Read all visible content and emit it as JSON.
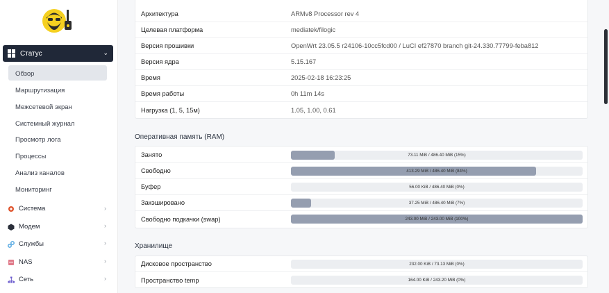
{
  "sidebar": {
    "status_label": "Статус",
    "sub_items": [
      {
        "label": "Обзор"
      },
      {
        "label": "Маршрутизация"
      },
      {
        "label": "Межсетевой экран"
      },
      {
        "label": "Системный журнал"
      },
      {
        "label": "Просмотр лога"
      },
      {
        "label": "Процессы"
      },
      {
        "label": "Анализ каналов"
      },
      {
        "label": "Мониторинг"
      }
    ],
    "groups": [
      {
        "label": "Система",
        "icon": "gear-icon",
        "color": "#e0552e"
      },
      {
        "label": "Модем",
        "icon": "cube-icon",
        "color": "#2a2f3a"
      },
      {
        "label": "Службы",
        "icon": "link-icon",
        "color": "#4aa3e0"
      },
      {
        "label": "NAS",
        "icon": "storage-icon",
        "color": "#e07a8a"
      },
      {
        "label": "Сеть",
        "icon": "network-icon",
        "color": "#6a5acd"
      }
    ]
  },
  "system": {
    "rows": [
      {
        "label": "Архитектура",
        "value": "ARMv8 Processor rev 4"
      },
      {
        "label": "Целевая платформа",
        "value": "mediatek/filogic"
      },
      {
        "label": "Версия прошивки",
        "value": "OpenWrt 23.05.5 r24106-10cc5fcd00 / LuCI ef27870 branch git-24.330.77799-feba812"
      },
      {
        "label": "Версия ядра",
        "value": "5.15.167"
      },
      {
        "label": "Время",
        "value": "2025-02-18 16:23:25"
      },
      {
        "label": "Время работы",
        "value": "0h 11m 14s"
      },
      {
        "label": "Нагрузка (1, 5, 15м)",
        "value": "1.05, 1.00, 0.61"
      }
    ]
  },
  "ram": {
    "title": "Оперативная память (RAM)",
    "rows": [
      {
        "label": "Занято",
        "text": "73.11 MiB / 486.40 MiB (15%)",
        "percent": 15
      },
      {
        "label": "Свободно",
        "text": "413.29 MiB / 486.40 MiB (84%)",
        "percent": 84
      },
      {
        "label": "Буфер",
        "text": "56.00 KiB / 486.40 MiB (0%)",
        "percent": 0
      },
      {
        "label": "Закэшировано",
        "text": "37.25 MiB / 486.40 MiB (7%)",
        "percent": 7
      },
      {
        "label": "Свободно подкачки (swap)",
        "text": "243.00 MiB / 243.00 MiB (100%)",
        "percent": 100
      }
    ]
  },
  "storage": {
    "title": "Хранилище",
    "rows": [
      {
        "label": "Дисковое пространство",
        "text": "232.00 KiB / 73.13 MiB (0%)",
        "percent": 0
      },
      {
        "label": "Пространство temp",
        "text": "164.00 KiB / 243.20 MiB (0%)",
        "percent": 0
      }
    ]
  }
}
